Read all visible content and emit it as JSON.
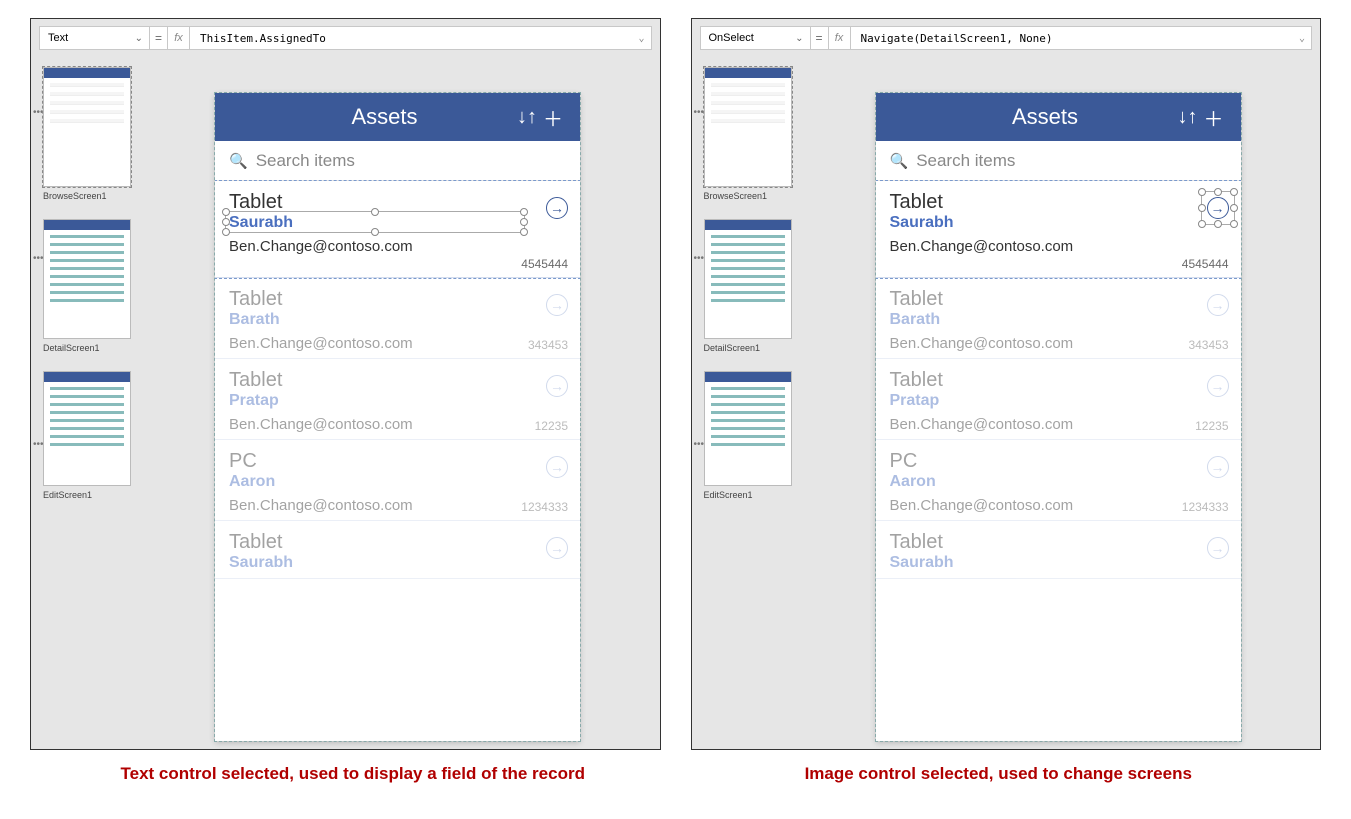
{
  "panels": {
    "left": {
      "propDropdown": "Text",
      "formula": "ThisItem.AssignedTo"
    },
    "right": {
      "propDropdown": "OnSelect",
      "formula": "Navigate(DetailScreen1, None)"
    }
  },
  "screens": [
    "BrowseScreen1",
    "DetailScreen1",
    "EditScreen1"
  ],
  "app": {
    "title": "Assets",
    "searchPlaceholder": "Search items",
    "rows": [
      {
        "title": "Tablet",
        "assigned": "Saurabh",
        "email": "Ben.Change@contoso.com",
        "num": "4545444",
        "active": true
      },
      {
        "title": "Tablet",
        "assigned": "Barath",
        "email": "Ben.Change@contoso.com",
        "num": "343453"
      },
      {
        "title": "Tablet",
        "assigned": "Pratap",
        "email": "Ben.Change@contoso.com",
        "num": "12235"
      },
      {
        "title": "PC",
        "assigned": "Aaron",
        "email": "Ben.Change@contoso.com",
        "num": "1234333"
      },
      {
        "title": "Tablet",
        "assigned": "Saurabh",
        "email": "Ben.Change@contoso.com",
        "num": ""
      }
    ]
  },
  "captions": {
    "left": "Text control selected, used to display a field of the record",
    "right": "Image control selected, used to change screens"
  }
}
